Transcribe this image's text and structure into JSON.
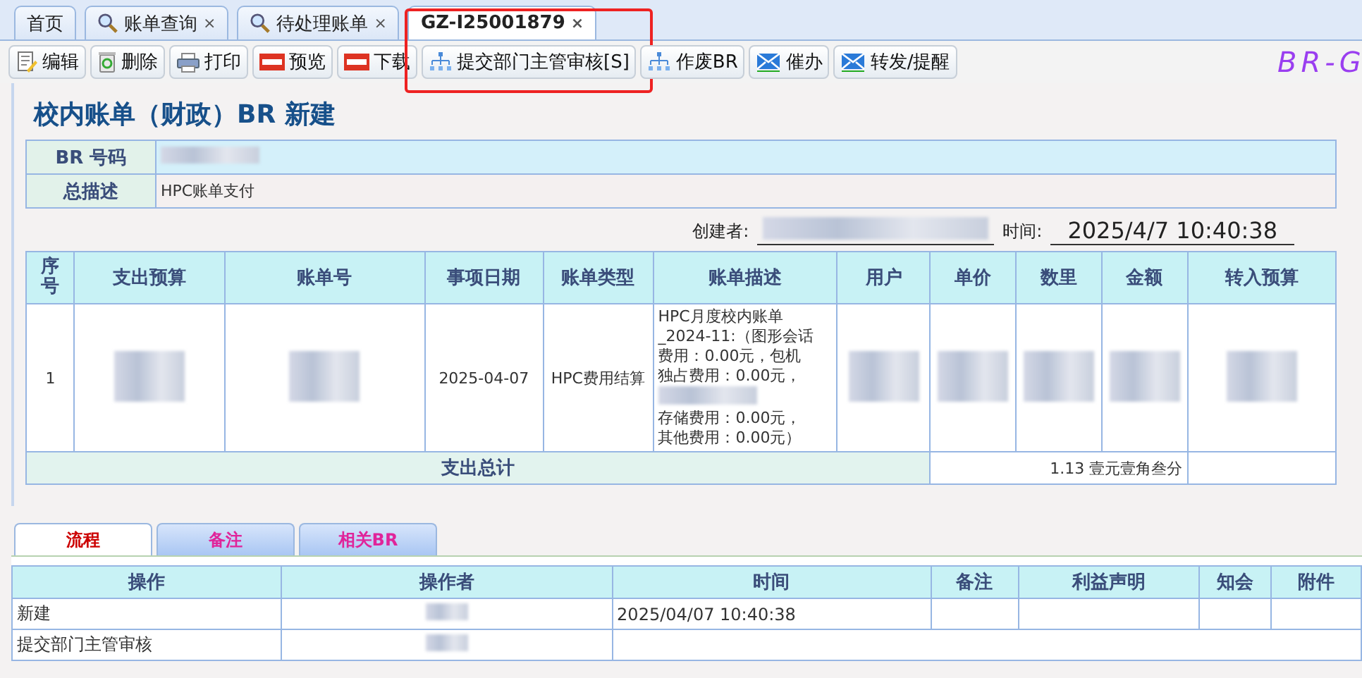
{
  "tabs": [
    {
      "label": "首页",
      "kind": "plain",
      "closable": false,
      "selected": false
    },
    {
      "label": "账单查询",
      "kind": "search",
      "closable": true,
      "selected": false
    },
    {
      "label": "待处理账单",
      "kind": "search",
      "closable": true,
      "selected": false
    },
    {
      "label": "GZ-I25001879",
      "kind": "plain",
      "closable": true,
      "selected": true
    }
  ],
  "close_glyph": "×",
  "toolbar": {
    "buttons": [
      {
        "label": "编辑",
        "kind": "edit",
        "highlighted": false
      },
      {
        "label": "删除",
        "kind": "delete",
        "highlighted": false
      },
      {
        "label": "打印",
        "kind": "print",
        "highlighted": false
      },
      {
        "label": "预览",
        "kind": "pdf",
        "highlighted": false
      },
      {
        "label": "下载",
        "kind": "pdf",
        "highlighted": false
      },
      {
        "label": "提交部门主管审核[S]",
        "kind": "org",
        "highlighted": true
      },
      {
        "label": "作废BR",
        "kind": "org",
        "highlighted": false
      },
      {
        "label": "催办",
        "kind": "mail",
        "highlighted": false
      },
      {
        "label": "转发/提醒",
        "kind": "mail",
        "highlighted": false
      }
    ],
    "brand": "BR-G"
  },
  "form": {
    "title": "校内账单（财政）BR 新建",
    "info": [
      {
        "label": "BR 号码",
        "kind": "redacted"
      },
      {
        "label": "总描述",
        "kind": "text",
        "value": "HPC账单支付"
      }
    ],
    "creator": {
      "label": "创建者:",
      "time_label": "时间:",
      "time": "2025/4/7 10:40:38"
    },
    "table": {
      "columns": [
        "序号",
        "支出预算",
        "账单号",
        "事项日期",
        "账单类型",
        "账单描述",
        "用户",
        "单价",
        "数里",
        "金额",
        "转入预算"
      ],
      "rows": [
        {
          "cells": [
            {
              "kind": "text",
              "text": "1"
            },
            {
              "kind": "redacted"
            },
            {
              "kind": "redacted"
            },
            {
              "kind": "text",
              "text": "2025-04-07"
            },
            {
              "kind": "text",
              "text": "HPC费用结算"
            },
            {
              "kind": "lines",
              "lines": [
                {
                  "kind": "text",
                  "text": "HPC月度校内账单"
                },
                {
                  "kind": "text",
                  "text": "_2024-11:（图形会话"
                },
                {
                  "kind": "text",
                  "text": "费用：0.00元，包机"
                },
                {
                  "kind": "text",
                  "text": "独占费用：0.00元，"
                },
                {
                  "kind": "redacted"
                },
                {
                  "kind": "text",
                  "text": "存储费用：0.00元，"
                },
                {
                  "kind": "text",
                  "text": "其他费用：0.00元）"
                }
              ]
            },
            {
              "kind": "redacted"
            },
            {
              "kind": "redacted"
            },
            {
              "kind": "redacted"
            },
            {
              "kind": "redacted"
            },
            {
              "kind": "redacted"
            }
          ]
        }
      ],
      "total": {
        "label": "支出总计",
        "amount": "1.13 壹元壹角叁分"
      }
    }
  },
  "bottom_tabs": [
    {
      "label": "流程",
      "selected": true
    },
    {
      "label": "备注",
      "selected": false
    },
    {
      "label": "相关BR",
      "selected": false
    }
  ],
  "flow": {
    "columns": [
      "操作",
      "操作者",
      "时间",
      "备注",
      "利益声明",
      "知会",
      "附件"
    ],
    "rows": [
      {
        "cells": [
          {
            "kind": "text",
            "text": "新建"
          },
          {
            "kind": "redacted"
          },
          {
            "kind": "text",
            "text": "2025/04/07 10:40:38"
          },
          {
            "kind": "empty"
          },
          {
            "kind": "empty"
          },
          {
            "kind": "empty"
          },
          {
            "kind": "empty"
          }
        ]
      },
      {
        "cells": [
          {
            "kind": "text",
            "text": "提交部门主管审核"
          },
          {
            "kind": "redacted"
          },
          {
            "kind": "wide"
          }
        ]
      }
    ]
  }
}
